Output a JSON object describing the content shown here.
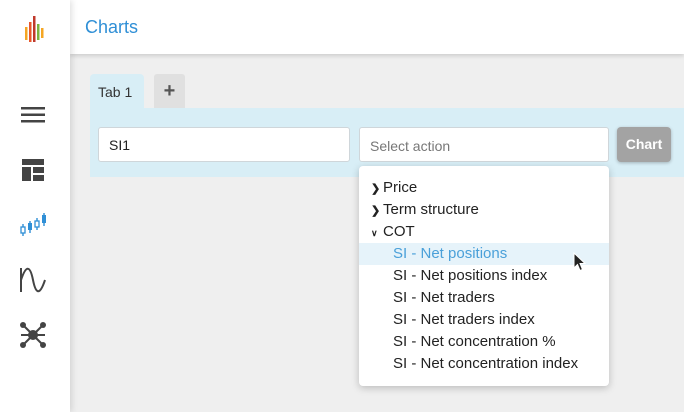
{
  "header": {
    "title": "Charts"
  },
  "sidebar": {
    "items": [
      {
        "icon": "menu-icon"
      },
      {
        "icon": "dashboard-icon"
      },
      {
        "icon": "candlestick-icon"
      },
      {
        "icon": "wave-icon"
      },
      {
        "icon": "network-icon"
      }
    ]
  },
  "tabs": [
    {
      "label": "Tab 1"
    }
  ],
  "tab_add_label": "+",
  "symbol_input": {
    "value": "SI1"
  },
  "action_select": {
    "placeholder": "Select action"
  },
  "chart_button": {
    "label": "Chart"
  },
  "dropdown": {
    "groups": [
      {
        "label": "Price",
        "expanded": false
      },
      {
        "label": "Term structure",
        "expanded": false
      },
      {
        "label": "COT",
        "expanded": true
      }
    ],
    "items": [
      {
        "label": "SI - Net positions",
        "highlighted": true
      },
      {
        "label": "SI - Net positions index"
      },
      {
        "label": "SI - Net traders"
      },
      {
        "label": "SI - Net traders index"
      },
      {
        "label": "SI - Net concentration %"
      },
      {
        "label": "SI - Net concentration index"
      }
    ]
  },
  "colors": {
    "accent": "#2f8fd6",
    "toolbar_bg": "#d8eef6",
    "highlight_text": "#4aa0d9",
    "button_gray": "#a3a3a3"
  }
}
